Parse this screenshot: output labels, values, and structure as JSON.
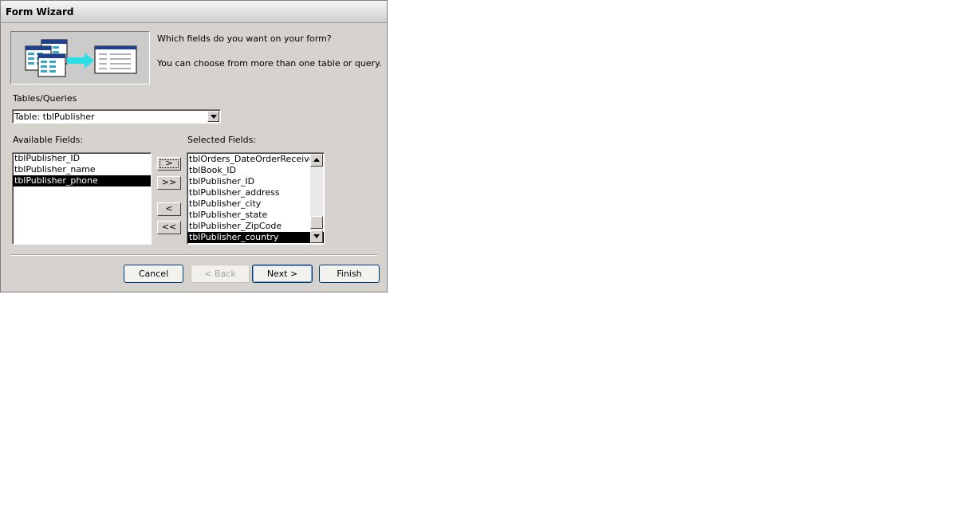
{
  "window": {
    "title": "Form Wizard"
  },
  "intro": {
    "question": "Which fields do you want on your form?",
    "hint": "You can choose from more than one table or query."
  },
  "tables_queries": {
    "label": "Tables/Queries",
    "selected": "Table: tblPublisher"
  },
  "available": {
    "label": "Available Fields:",
    "items": [
      "tblPublisher_ID",
      "tblPublisher_name",
      "tblPublisher_phone"
    ],
    "selected_index": 2
  },
  "selected": {
    "label": "Selected Fields:",
    "items": [
      "tblOrders_DateOrderReceived",
      "tblBook_ID",
      "tblPublisher_ID",
      "tblPublisher_address",
      "tblPublisher_city",
      "tblPublisher_state",
      "tblPublisher_ZipCode",
      "tblPublisher_country"
    ],
    "selected_index": 7
  },
  "move_buttons": {
    "add_one": ">",
    "add_all": ">>",
    "remove_one": "<",
    "remove_all": "<<"
  },
  "buttons": {
    "cancel": "Cancel",
    "back": "< Back",
    "next": "Next >",
    "finish": "Finish"
  }
}
